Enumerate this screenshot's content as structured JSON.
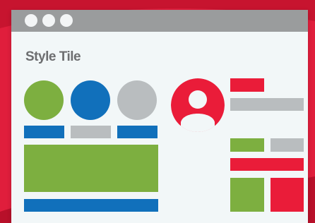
{
  "window": {
    "title": "Style Tile",
    "controls": [
      "window-dot-icon",
      "window-dot-icon",
      "window-dot-icon"
    ]
  },
  "colors": {
    "background": "#e01e3c",
    "window_bg": "#f2f7f8",
    "titlebar": "#9a9c9d",
    "title_text": "#6d6e70",
    "green": "#7daf40",
    "blue": "#1170bb",
    "gray": "#b9bdbf",
    "red": "#ea1c39"
  },
  "icons": {
    "avatar": "user-avatar-icon"
  }
}
